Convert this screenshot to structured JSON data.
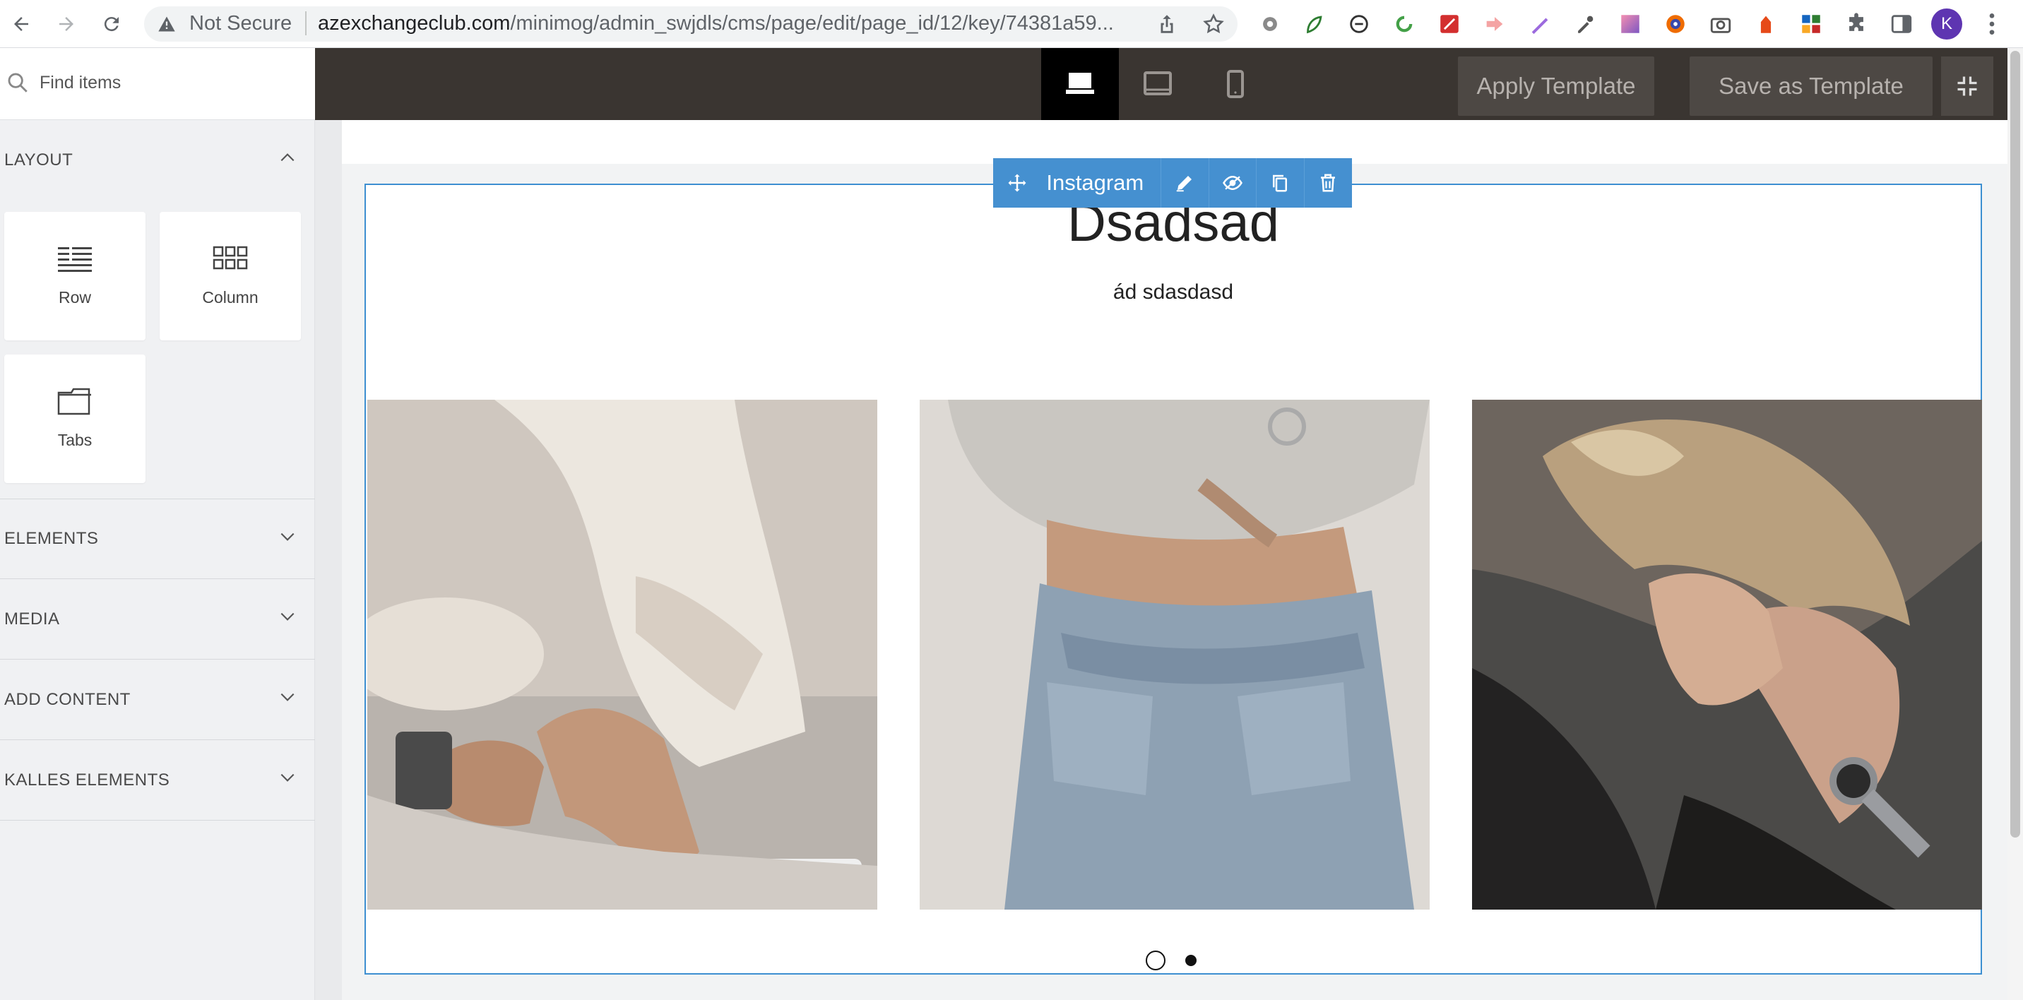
{
  "browser": {
    "security_label": "Not Secure",
    "url_host": "azexchangeclub.com",
    "url_path": "/minimog/admin_swjdls/cms/page/edit/page_id/12/key/74381a59...",
    "profile_initial": "K",
    "extensions": [
      "settings-gear-icon",
      "leaf-extension-icon",
      "sync-extension-icon",
      "refresh-extension-icon",
      "pdf-extension-icon",
      "arrow-extension-icon",
      "pen-extension-icon",
      "eyedropper-icon",
      "gradient-extension-icon",
      "color-wheel-icon",
      "camera-icon",
      "hand-extension-icon",
      "grid-extension-icon",
      "puzzle-icon",
      "reading-list-icon"
    ]
  },
  "sidebar": {
    "search_placeholder": "Find items",
    "layout": {
      "title": "LAYOUT",
      "blocks": [
        {
          "label": "Row",
          "icon": "row-icon"
        },
        {
          "label": "Column",
          "icon": "column-icon"
        },
        {
          "label": "Tabs",
          "icon": "tabs-icon"
        }
      ]
    },
    "sections": [
      {
        "title": "ELEMENTS"
      },
      {
        "title": "MEDIA"
      },
      {
        "title": "ADD CONTENT"
      },
      {
        "title": "KALLES ELEMENTS"
      }
    ]
  },
  "editor": {
    "devices": [
      "desktop-icon",
      "tablet-icon",
      "mobile-icon"
    ],
    "active_device": "desktop",
    "apply_template_label": "Apply Template",
    "save_template_label": "Save as Template"
  },
  "section": {
    "toolbar_label": "Instagram",
    "heading": "Dsadsad",
    "subheading": "ád sdasdasd",
    "slider_pages": 2,
    "active_page": 2
  },
  "colors": {
    "editor_bar": "#3a3531",
    "accent_blue": "#4590d0",
    "profile": "#5e35b1"
  }
}
